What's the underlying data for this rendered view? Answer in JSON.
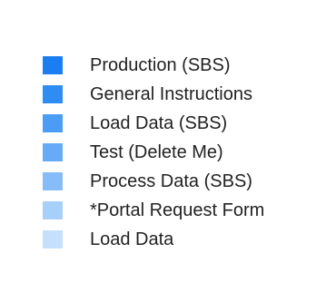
{
  "chart_data": {
    "type": "bar",
    "legend": {
      "placement": "right",
      "entries": [
        {
          "name": "Production (SBS)",
          "color": "#1a7df2"
        },
        {
          "name": "General Instructions",
          "color": "#2f8cf3"
        },
        {
          "name": "Load Data (SBS)",
          "color": "#4a9cf5"
        },
        {
          "name": "Test (Delete Me)",
          "color": "#66abf7"
        },
        {
          "name": "Process Data (SBS)",
          "color": "#86bdf8"
        },
        {
          "name": "*Portal Request Form",
          "color": "#a6d0fa"
        },
        {
          "name": "Load Data",
          "color": "#c4e0fc"
        }
      ]
    }
  }
}
